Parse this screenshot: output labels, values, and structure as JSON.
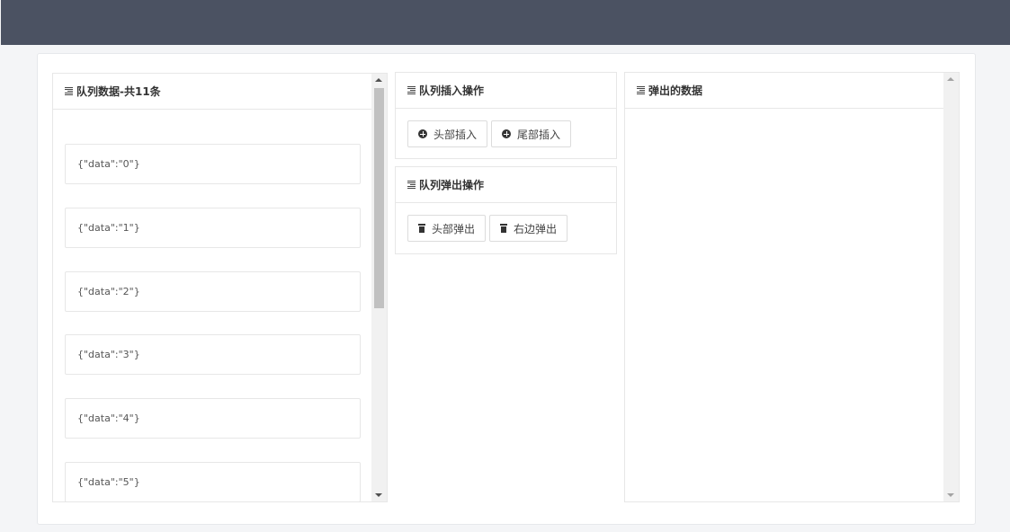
{
  "queue_panel": {
    "title": "队列数据-共11条",
    "items": [
      "{\"data\":\"0\"}",
      "{\"data\":\"1\"}",
      "{\"data\":\"2\"}",
      "{\"data\":\"3\"}",
      "{\"data\":\"4\"}",
      "{\"data\":\"5\"}"
    ]
  },
  "insert_panel": {
    "title": "队列插入操作",
    "head_insert_label": "头部插入",
    "tail_insert_label": "尾部插入"
  },
  "pop_panel": {
    "title": "队列弹出操作",
    "head_pop_label": "头部弹出",
    "right_pop_label": "右边弹出"
  },
  "popped_panel": {
    "title": "弹出的数据"
  },
  "colors": {
    "topbar": "#4b5262",
    "background": "#f4f5f7",
    "border": "#e7e7e7"
  }
}
